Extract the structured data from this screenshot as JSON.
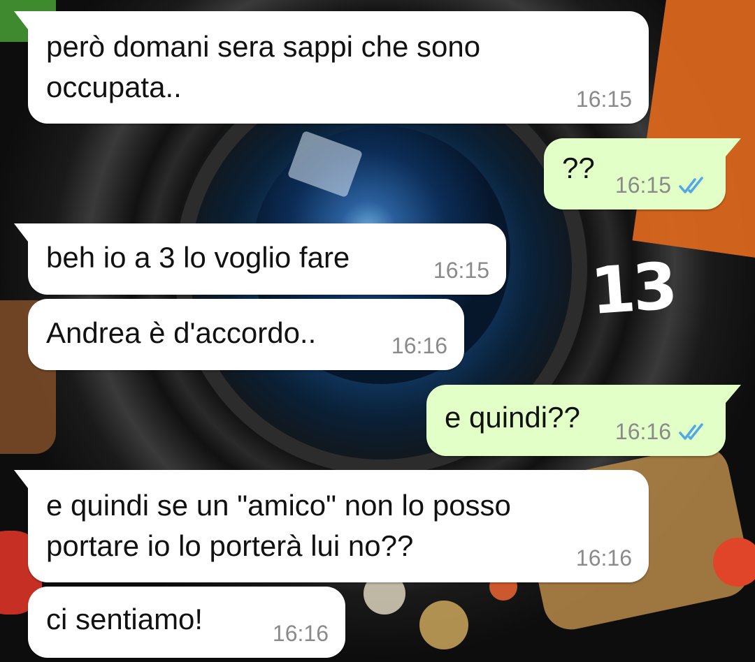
{
  "overlay_annotation": "13",
  "messages": [
    {
      "direction": "incoming",
      "text": "però domani sera sappi che sono\noccupata..",
      "time": "16:15"
    },
    {
      "direction": "outgoing",
      "text": "??",
      "time": "16:15",
      "status": "read-double-check-icon"
    },
    {
      "direction": "incoming",
      "text": "beh io a 3 lo voglio fare",
      "time": "16:15"
    },
    {
      "direction": "incoming",
      "text": "Andrea è d'accordo..",
      "time": "16:16"
    },
    {
      "direction": "outgoing",
      "text": "e quindi??",
      "time": "16:16",
      "status": "read-double-check-icon"
    },
    {
      "direction": "incoming",
      "text": "e quindi se un \"amico\" non lo posso\nportare io lo porterà lui no??",
      "time": "16:16"
    },
    {
      "direction": "incoming",
      "text": "ci sentiamo!",
      "time": "16:16"
    }
  ],
  "colors": {
    "incoming_bubble": "#ffffff",
    "outgoing_bubble": "#e2ffc7",
    "read_ticks": "#4fa9e6",
    "timestamp": "#8a8a8a"
  }
}
